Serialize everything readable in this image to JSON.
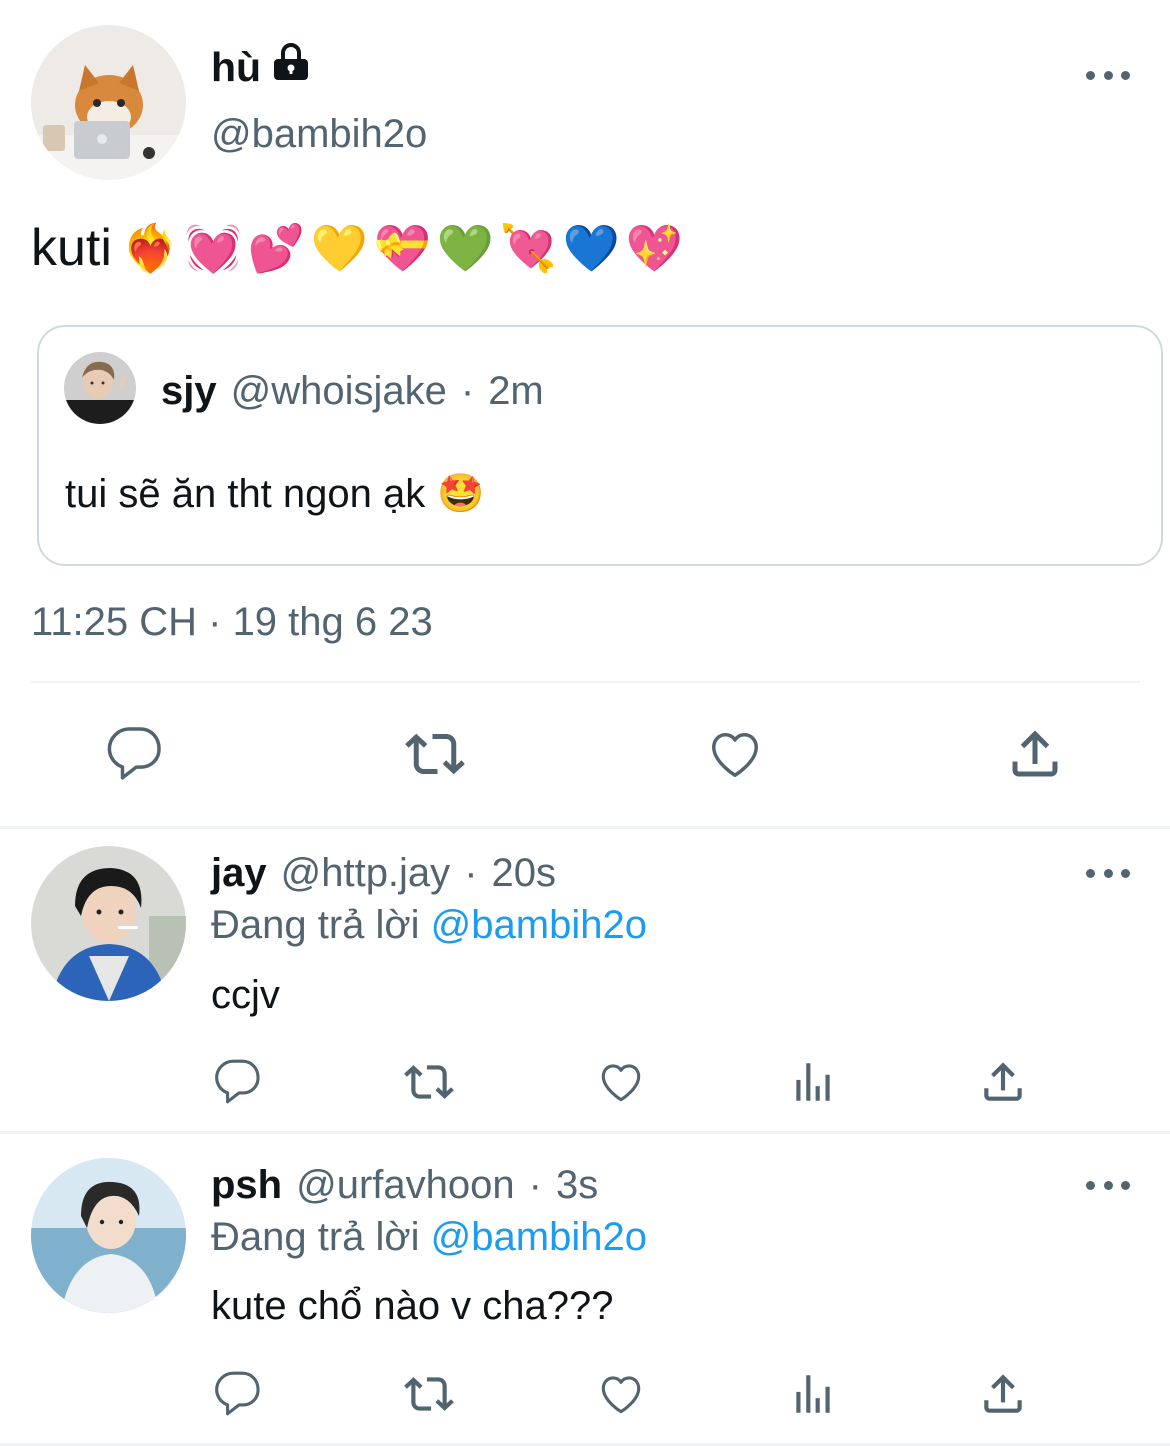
{
  "main_tweet": {
    "author": {
      "name": "hù",
      "handle": "@bambih2o",
      "protected": true
    },
    "text": "kuti",
    "emojis": [
      "❤️‍🔥",
      "💓",
      "💕",
      "💛",
      "💝",
      "💚",
      "💘",
      "💙",
      "💖"
    ],
    "quote": {
      "name": "sjy",
      "handle": "@whoisjake",
      "dot": "·",
      "time": "2m",
      "text": "tui sẽ ăn tht ngon ạk",
      "emoji": "🤩"
    },
    "timestamp": "11:25 CH · 19 thg 6 23"
  },
  "replies": [
    {
      "name": "jay",
      "handle": "@http.jay",
      "dot": "·",
      "time": "20s",
      "replying_prefix": "Đang trả lời",
      "replying_to": "@bambih2o",
      "text": "ccjv"
    },
    {
      "name": "psh",
      "handle": "@urfavhoon",
      "dot": "·",
      "time": "3s",
      "replying_prefix": "Đang trả lời",
      "replying_to": "@bambih2o",
      "text": "kute chổ nào v cha???"
    }
  ],
  "colors": {
    "text": "#0f1419",
    "secondary": "#536471",
    "link": "#1d9bf0",
    "border": "#cfd9de",
    "divider": "#eff3f4"
  },
  "icons": {
    "more": "more-horizontal-icon",
    "reply": "reply-icon",
    "retweet": "retweet-icon",
    "like": "heart-icon",
    "views": "views-icon",
    "share": "share-icon",
    "lock": "lock-icon"
  }
}
